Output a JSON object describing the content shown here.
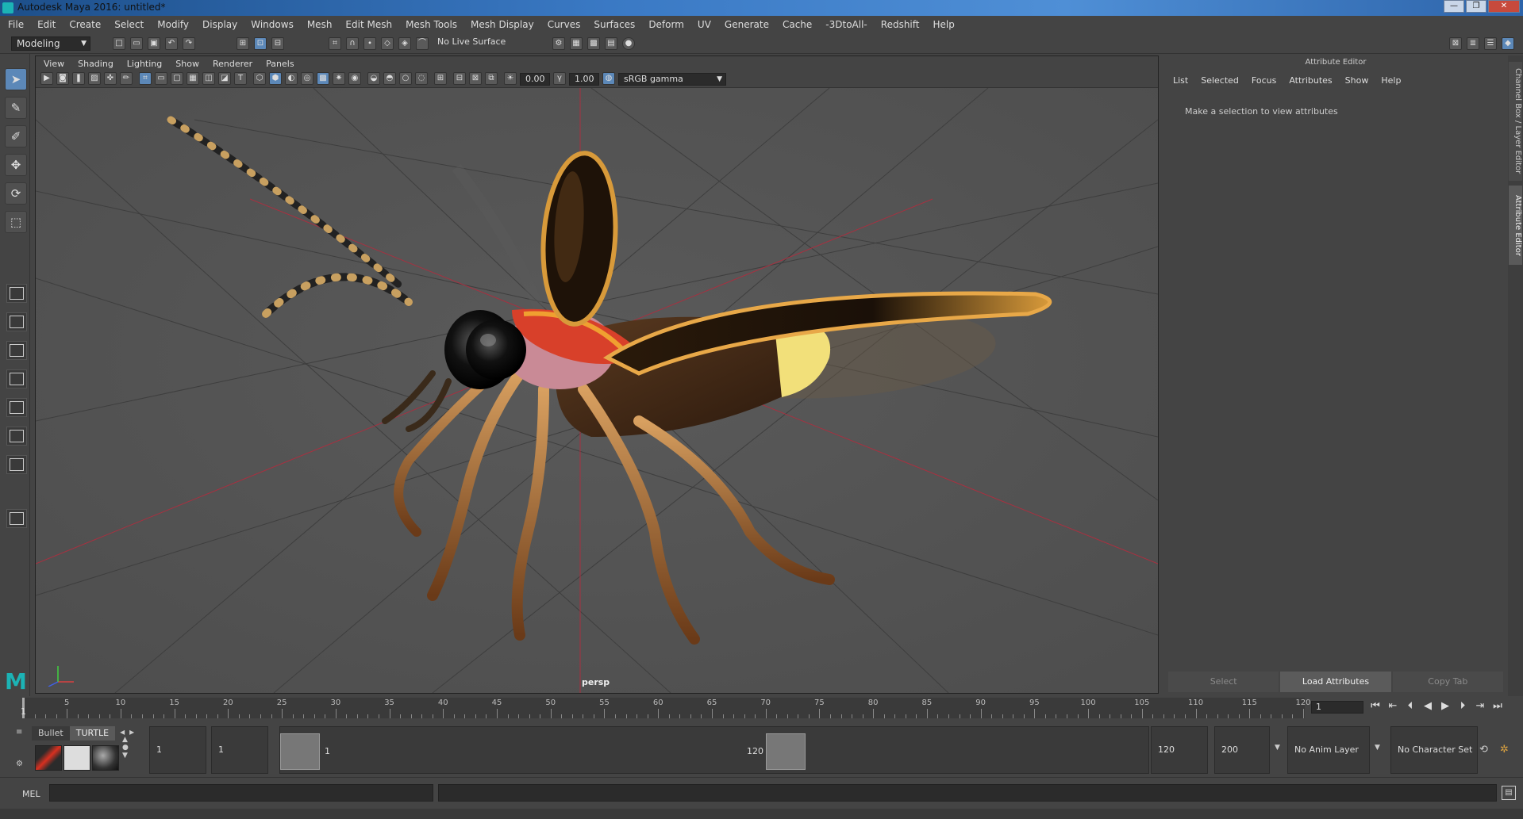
{
  "window": {
    "title": "Autodesk Maya 2016: untitled*"
  },
  "menubar": [
    "File",
    "Edit",
    "Create",
    "Select",
    "Modify",
    "Display",
    "Windows",
    "Mesh",
    "Edit Mesh",
    "Mesh Tools",
    "Mesh Display",
    "Curves",
    "Surfaces",
    "Deform",
    "UV",
    "Generate",
    "Cache",
    "-3DtoAll-",
    "Redshift",
    "Help"
  ],
  "statusline": {
    "mode": "Modeling",
    "live_surface": "No Live Surface"
  },
  "viewport": {
    "menu": [
      "View",
      "Shading",
      "Lighting",
      "Show",
      "Renderer",
      "Panels"
    ],
    "exposure": "0.00",
    "gamma": "1.00",
    "color_space": "sRGB gamma",
    "camera_label": "persp"
  },
  "attribute_editor": {
    "title": "Attribute Editor",
    "menu": [
      "List",
      "Selected",
      "Focus",
      "Attributes",
      "Show",
      "Help"
    ],
    "message": "Make a selection to view attributes",
    "buttons": {
      "select": "Select",
      "load": "Load Attributes",
      "copy": "Copy Tab"
    },
    "side_tabs": {
      "channel_box": "Channel Box / Layer Editor",
      "attribute_editor": "Attribute Editor"
    }
  },
  "timeslider": {
    "ticks": [
      5,
      10,
      15,
      20,
      25,
      30,
      35,
      40,
      45,
      50,
      55,
      60,
      65,
      70,
      75,
      80,
      85,
      90,
      95,
      100,
      105,
      110,
      115,
      120
    ],
    "start_label": "1",
    "current_frame": "1"
  },
  "rangeslider": {
    "shelf_tabs": [
      "Bullet",
      "TURTLE"
    ],
    "anim_start": "1",
    "range_start": "1",
    "playback_start": "1",
    "playback_end": "120",
    "range_end": "120",
    "anim_end": "200",
    "anim_layer": "No Anim Layer",
    "character_set": "No Character Set"
  },
  "cmdline": {
    "label": "MEL"
  }
}
